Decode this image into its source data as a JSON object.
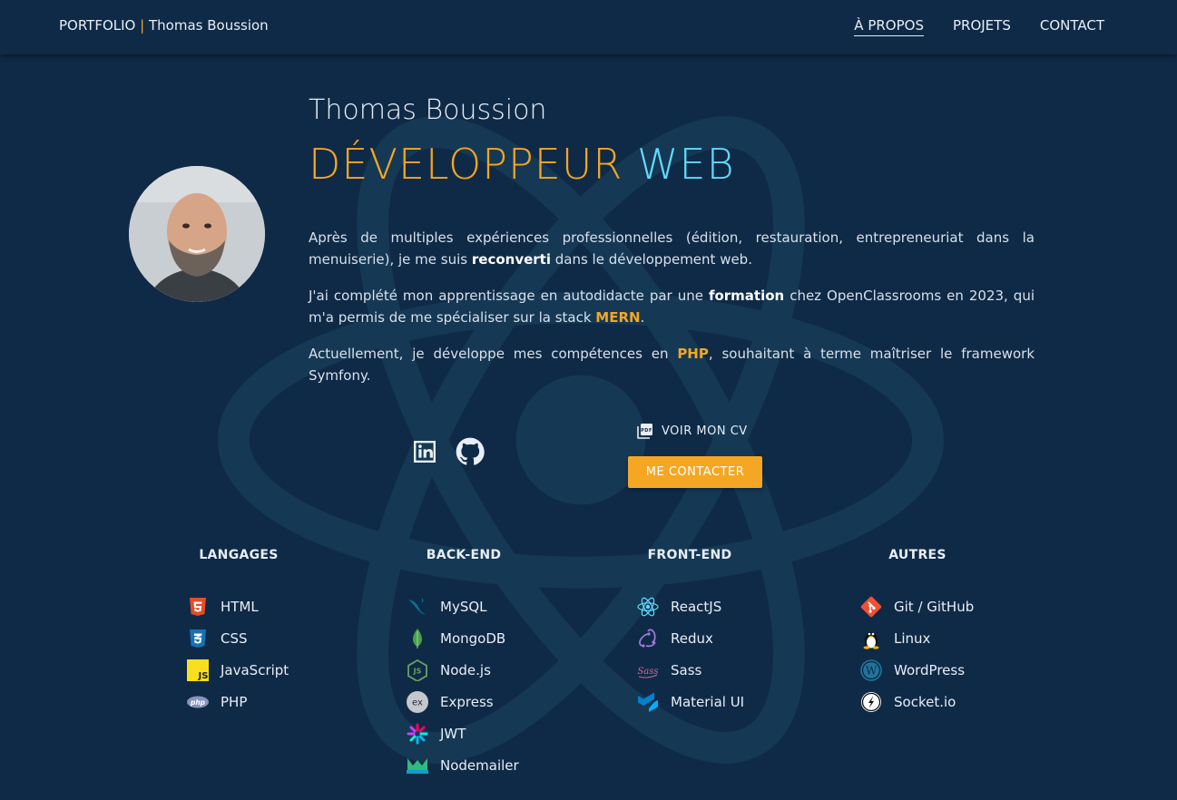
{
  "header": {
    "brand_prefix": "PORTFOLIO",
    "brand_sep": "|",
    "brand_name": "Thomas Boussion",
    "nav": [
      "À PROPOS",
      "PROJETS",
      "CONTACT"
    ]
  },
  "hero": {
    "name": "Thomas Boussion",
    "title_part1": "DÉVELOPPEUR",
    "title_part2": "WEB",
    "p1_a": "Après de multiples expériences professionnelles (édition, restauration, entrepreneuriat dans la menuiserie), je me suis ",
    "p1_b": "reconverti",
    "p1_c": " dans le développement web.",
    "p2_a": "J'ai complété mon apprentissage en autodidacte par une ",
    "p2_b": "formation",
    "p2_c": " chez OpenClassrooms en 2023, qui m'a permis de me spécialiser sur la stack ",
    "p2_d": "MERN",
    "p2_e": ".",
    "p3_a": "Actuellement, je développe mes compétences en ",
    "p3_b": "PHP",
    "p3_c": ", souhaitant à terme maîtriser le framework Symfony."
  },
  "actions": {
    "cv_label": "VOIR MON CV",
    "contact_label": "ME CONTACTER"
  },
  "skills": {
    "langages": {
      "title": "LANGAGES",
      "items": [
        "HTML",
        "CSS",
        "JavaScript",
        "PHP"
      ]
    },
    "backend": {
      "title": "BACK-END",
      "items": [
        "MySQL",
        "MongoDB",
        "Node.js",
        "Express",
        "JWT",
        "Nodemailer"
      ]
    },
    "frontend": {
      "title": "FRONT-END",
      "items": [
        "ReactJS",
        "Redux",
        "Sass",
        "Material UI"
      ]
    },
    "autres": {
      "title": "AUTRES",
      "items": [
        "Git / GitHub",
        "Linux",
        "WordPress",
        "Socket.io"
      ]
    }
  },
  "colors": {
    "background": "#0f2a47",
    "accent": "#f5a623",
    "react_blue": "#61dafb"
  }
}
